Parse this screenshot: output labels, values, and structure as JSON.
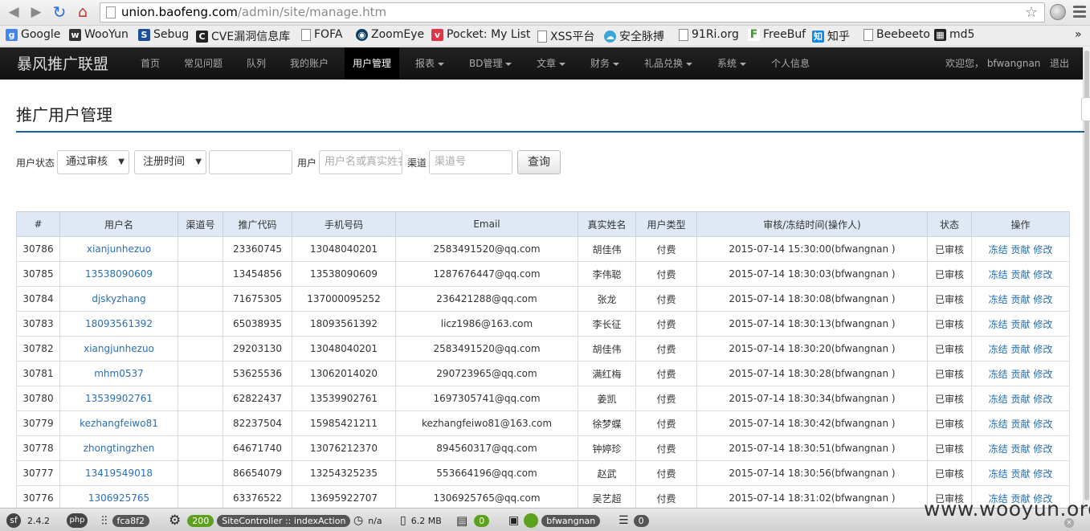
{
  "browser": {
    "url_host": "union.baofeng.com",
    "url_path": "/admin/site/manage.htm",
    "bookmarks": [
      "Google",
      "WooYun",
      "Sebug",
      "CVE漏洞信息库",
      "FOFA",
      "ZoomEye",
      "Pocket: My List",
      "XSS平台",
      "安全脉搏",
      "91Ri.org",
      "FreeBuf",
      "知乎",
      "Beebeeto",
      "md5"
    ],
    "more": "»"
  },
  "navbar": {
    "brand": "暴风推广联盟",
    "items": [
      "首页",
      "常见问题",
      "队列",
      "我的账户",
      "用户管理",
      "报表",
      "BD管理",
      "文章",
      "财务",
      "礼品兑换",
      "系统",
      "个人信息"
    ],
    "welcome": "欢迎您， bfwangnan",
    "logout": "退出"
  },
  "page": {
    "title": "推广用户管理"
  },
  "filter": {
    "status_label": "用户状态",
    "status_value": "通过审核",
    "time_value": "注册时间",
    "user_label": "用户",
    "user_placeholder": "用户名或真实姓名",
    "channel_label": "渠道",
    "channel_placeholder": "渠道号",
    "query_button": "查询"
  },
  "table": {
    "headers": [
      "#",
      "用户名",
      "渠道号",
      "推广代码",
      "手机号码",
      "Email",
      "真实姓名",
      "用户类型",
      "审核/冻结时间(操作人)",
      "状态",
      "操作"
    ],
    "actions": [
      "冻结",
      "贡献",
      "修改"
    ],
    "rows": [
      [
        "30786",
        "xianjunhezuo",
        "",
        "23360745",
        "13048040201",
        "2583491520@qq.com",
        "胡佳伟",
        "付费",
        "2015-07-14 15:30:00(bfwangnan )",
        "已审核"
      ],
      [
        "30785",
        "13538090609",
        "",
        "13454856",
        "13538090609",
        "1287676447@qq.com",
        "李伟聪",
        "付费",
        "2015-07-14 18:30:03(bfwangnan )",
        "已审核"
      ],
      [
        "30784",
        "djskyzhang",
        "",
        "71675305",
        "137000095252",
        "236421288@qq.com",
        "张龙",
        "付费",
        "2015-07-14 18:30:08(bfwangnan )",
        "已审核"
      ],
      [
        "30783",
        "18093561392",
        "",
        "65038935",
        "18093561392",
        "licz1986@163.com",
        "李长征",
        "付费",
        "2015-07-14 18:30:13(bfwangnan )",
        "已审核"
      ],
      [
        "30782",
        "xiangjunhezuo",
        "",
        "29203130",
        "13048040201",
        "2583491520@qq.com",
        "胡佳伟",
        "付费",
        "2015-07-14 18:30:20(bfwangnan )",
        "已审核"
      ],
      [
        "30781",
        "mhm0537",
        "",
        "53625536",
        "13062014020",
        "290723965@qq.com",
        "满红梅",
        "付费",
        "2015-07-14 18:30:28(bfwangnan )",
        "已审核"
      ],
      [
        "30780",
        "13539902761",
        "",
        "62822437",
        "13539902761",
        "1697305741@qq.com",
        "姜凯",
        "付费",
        "2015-07-14 18:30:34(bfwangnan )",
        "已审核"
      ],
      [
        "30779",
        "kezhangfeiwo81",
        "",
        "82237504",
        "15985421211",
        "kezhangfeiwo81@163.com",
        "徐梦蝶",
        "付费",
        "2015-07-14 18:30:42(bfwangnan )",
        "已审核"
      ],
      [
        "30778",
        "zhongtingzhen",
        "",
        "64671740",
        "13076212370",
        "894560317@qq.com",
        "钟婷珍",
        "付费",
        "2015-07-14 18:30:51(bfwangnan )",
        "已审核"
      ],
      [
        "30777",
        "13419549018",
        "",
        "86654079",
        "13254325235",
        "553664196@qq.com",
        "赵武",
        "付费",
        "2015-07-14 18:30:56(bfwangnan )",
        "已审核"
      ],
      [
        "30776",
        "1306925765",
        "",
        "63376522",
        "13695922707",
        "1306925765@qq.com",
        "吴艺超",
        "付费",
        "2015-07-14 18:31:02(bfwangnan )",
        "已审核"
      ]
    ]
  },
  "sfbar": {
    "version": "2.4.2",
    "php": "php",
    "token": "fca8f2",
    "status": "200",
    "controller": "SiteController :: indexAction",
    "time": "n/a",
    "memory": "6.2 MB",
    "logs": "0",
    "user": "bfwangnan",
    "db": "0"
  },
  "watermark": "www.wooyun.org"
}
